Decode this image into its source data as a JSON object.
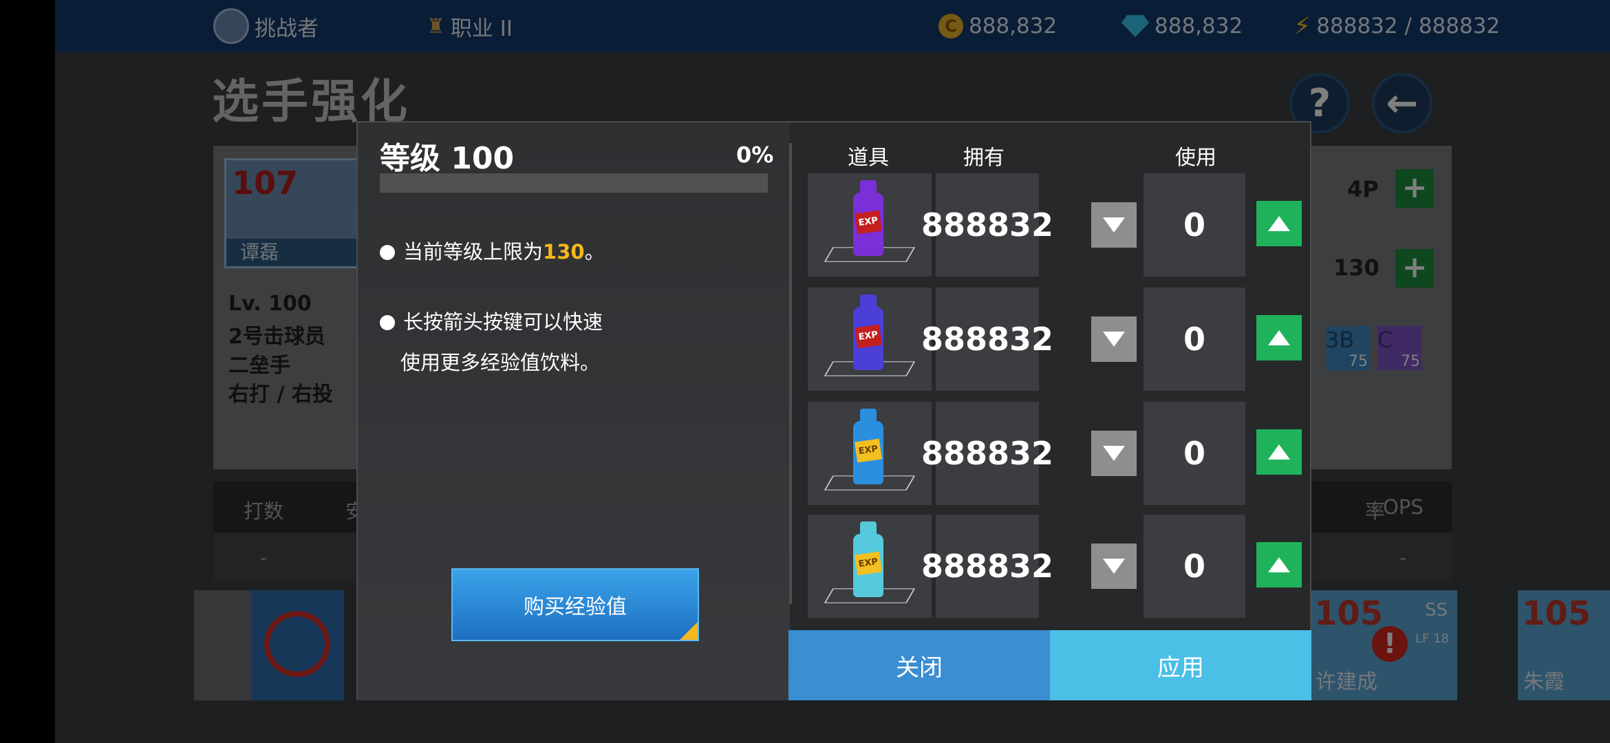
{
  "topbar": {
    "user_label": "挑战者",
    "rank_label": "职业 II",
    "coins": "888,832",
    "gems": "888,832",
    "energy": "888832 / 888832"
  },
  "page": {
    "title": "选手强化"
  },
  "player": {
    "ovr": "107",
    "name": "谭磊",
    "level": "Lv. 100",
    "order": "2号击球员",
    "position": "二垒手",
    "hand": "右打 / 右投",
    "right_val_1": "4P",
    "right_val_2": "130",
    "pos_3b": "3B",
    "pos_3b_val": "75",
    "pos_c": "C",
    "pos_c_val": "75"
  },
  "stats": {
    "col1": "打数",
    "col1_partial": "安",
    "col_rate_partial": "率",
    "col_ops": "OPS",
    "dash": "-"
  },
  "bottom_cards": [
    {
      "ovr": "105",
      "name": "许建成",
      "pos": "SS",
      "sub": "LF 18"
    },
    {
      "ovr": "105",
      "name": "朱霞"
    }
  ],
  "modal": {
    "level_label": "等级 100",
    "level_pct": "0%",
    "exp_progress": 0,
    "tip1_prefix": "当前等级上限为",
    "tip1_value": "130",
    "tip1_suffix": "。",
    "tip2_line1": "长按箭头按键可以快速",
    "tip2_line2": "使用更多经验值饮料。",
    "buy_label": "购买经验值",
    "col_item": "道具",
    "col_owned": "拥有",
    "col_use": "使用",
    "items": [
      {
        "owned": "888832",
        "use": "0",
        "color": "#7b2fd6",
        "label": "EXP"
      },
      {
        "owned": "888832",
        "use": "0",
        "color": "#4b3fd8",
        "label": "EXP"
      },
      {
        "owned": "888832",
        "use": "0",
        "color": "#2b8fe0",
        "label": "EXP"
      },
      {
        "owned": "888832",
        "use": "0",
        "color": "#56c9dc",
        "label": "EXP"
      }
    ],
    "close_label": "关闭",
    "apply_label": "应用"
  }
}
